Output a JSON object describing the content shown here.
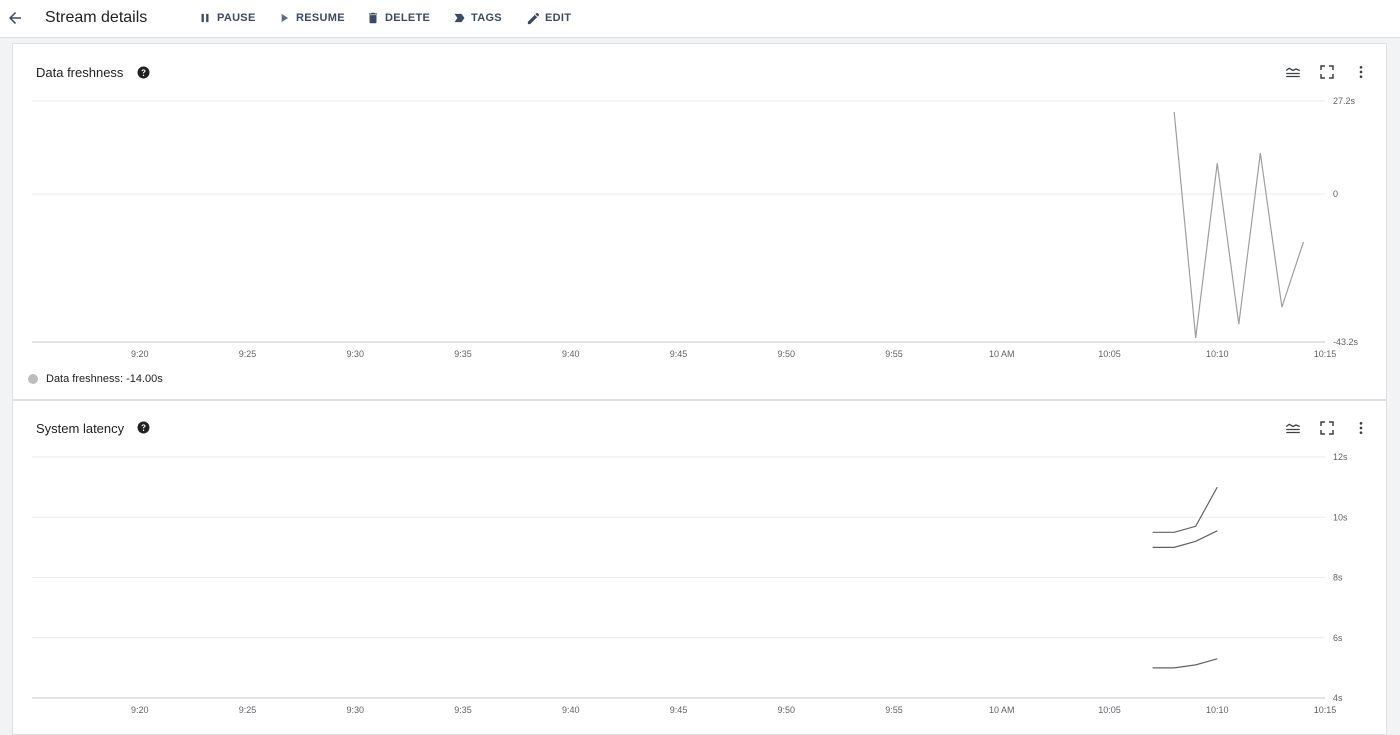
{
  "header": {
    "title": "Stream details",
    "actions": [
      {
        "label": "PAUSE",
        "icon": "pause-icon"
      },
      {
        "label": "RESUME",
        "icon": "play-icon"
      },
      {
        "label": "DELETE",
        "icon": "trash-icon"
      },
      {
        "label": "TAGS",
        "icon": "tag-icon"
      },
      {
        "label": "EDIT",
        "icon": "pencil-icon"
      }
    ]
  },
  "colors": {
    "accent": "#3c4a62",
    "series": "#9e9e9e",
    "series_dark": "#616161",
    "grid": "#e8eaed"
  },
  "cards": [
    {
      "title": "Data freshness",
      "legend": "Data freshness: -14.00s",
      "tools": [
        "legend-toggle-icon",
        "fullscreen-icon",
        "more-vert-icon"
      ]
    },
    {
      "title": "System latency",
      "tools": [
        "legend-toggle-icon",
        "fullscreen-icon",
        "more-vert-icon"
      ]
    }
  ],
  "chart_data": [
    {
      "type": "line",
      "title": "Data freshness",
      "x_ticks": [
        "9:20",
        "9:25",
        "9:30",
        "9:35",
        "9:40",
        "9:45",
        "9:50",
        "9:55",
        "10 AM",
        "10:05",
        "10:10",
        "10:15"
      ],
      "x_range_minutes": [
        15.0,
        75.0
      ],
      "y_ticks": [
        {
          "value": 27.2,
          "label": "27.2s"
        },
        {
          "value": 0,
          "label": "0"
        },
        {
          "value": -43.2,
          "label": "-43.2s"
        }
      ],
      "ylim": [
        -43.2,
        27.2
      ],
      "grid": true,
      "legend_position": "bottom-left",
      "series": [
        {
          "x": [
            68.0,
            69.0,
            70.0,
            71.0,
            72.0,
            73.0,
            74.0
          ],
          "y": [
            24.0,
            -42.0,
            9.0,
            -38.0,
            12.0,
            -33.0,
            -14.0
          ]
        }
      ]
    },
    {
      "type": "line",
      "title": "System latency",
      "x_ticks": [
        "9:20",
        "9:25",
        "9:30",
        "9:35",
        "9:40",
        "9:45",
        "9:50",
        "9:55",
        "10 AM",
        "10:05",
        "10:10",
        "10:15"
      ],
      "x_range_minutes": [
        15.0,
        75.0
      ],
      "y_ticks": [
        {
          "value": 12,
          "label": "12s"
        },
        {
          "value": 10,
          "label": "10s"
        },
        {
          "value": 8,
          "label": "8s"
        },
        {
          "value": 6,
          "label": "6s"
        },
        {
          "value": 4,
          "label": "4s"
        }
      ],
      "ylim": [
        4,
        12
      ],
      "grid": true,
      "series": [
        {
          "x": [
            67.0,
            68.0,
            69.0,
            70.0
          ],
          "y": [
            9.5,
            9.5,
            9.7,
            11.0
          ]
        },
        {
          "x": [
            67.0,
            68.0,
            69.0,
            70.0
          ],
          "y": [
            9.0,
            9.0,
            9.2,
            9.55
          ]
        },
        {
          "x": [
            67.0,
            68.0,
            69.0,
            70.0
          ],
          "y": [
            5.0,
            5.0,
            5.1,
            5.3
          ]
        }
      ]
    }
  ]
}
